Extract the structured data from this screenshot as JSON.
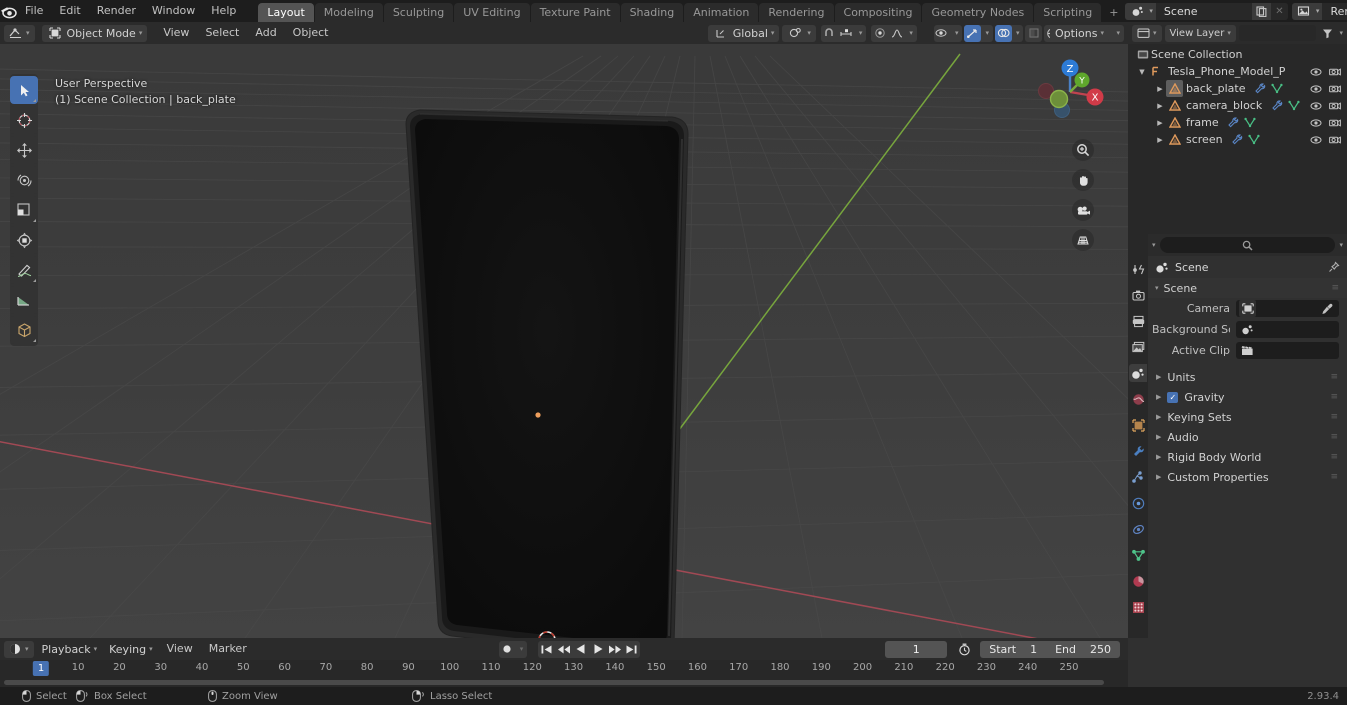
{
  "app": {
    "name": "Blender",
    "version": "2.93.4"
  },
  "topbar": {
    "menus": [
      "File",
      "Edit",
      "Render",
      "Window",
      "Help"
    ],
    "workspace_tabs": [
      {
        "label": "Layout",
        "active": true
      },
      {
        "label": "Modeling",
        "active": false
      },
      {
        "label": "Sculpting",
        "active": false
      },
      {
        "label": "UV Editing",
        "active": false
      },
      {
        "label": "Texture Paint",
        "active": false
      },
      {
        "label": "Shading",
        "active": false
      },
      {
        "label": "Animation",
        "active": false
      },
      {
        "label": "Rendering",
        "active": false
      },
      {
        "label": "Compositing",
        "active": false
      },
      {
        "label": "Geometry Nodes",
        "active": false
      },
      {
        "label": "Scripting",
        "active": false
      }
    ],
    "add_workspace_label": "+",
    "scene_name": "Scene",
    "viewlayer_name": "RenderLayer"
  },
  "viewport_header": {
    "mode": "Object Mode",
    "menus": [
      "View",
      "Select",
      "Add",
      "Object"
    ],
    "transform_orientation": "Global",
    "options_label": "Options"
  },
  "viewport": {
    "perspective_label": "User Perspective",
    "collection_label": "(1) Scene Collection | back_plate",
    "gizmo_axes": [
      "Z",
      "Y",
      "X"
    ],
    "tools": [
      "tweak-select-tool",
      "cursor-tool",
      "move-tool",
      "rotate-tool",
      "scale-tool",
      "transform-tool",
      "annotate-tool",
      "measure-tool",
      "add-cube-tool"
    ],
    "nav_buttons": [
      "zoom-icon",
      "pan-hand-icon",
      "camera-view-icon",
      "toggle-perspective-icon"
    ]
  },
  "outliner": {
    "scene_collection_label": "Scene Collection",
    "items": [
      {
        "label": "Tesla_Phone_Model_Pi_Screen",
        "type": "armature-collection",
        "depth": 0,
        "selected": false,
        "expanded": true
      },
      {
        "label": "back_plate",
        "type": "mesh",
        "depth": 1,
        "selected": true,
        "expanded": false
      },
      {
        "label": "camera_block",
        "type": "mesh",
        "depth": 1,
        "selected": false,
        "expanded": false
      },
      {
        "label": "frame",
        "type": "mesh",
        "depth": 1,
        "selected": false,
        "expanded": false
      },
      {
        "label": "screen",
        "type": "mesh",
        "depth": 1,
        "selected": false,
        "expanded": false
      }
    ]
  },
  "properties": {
    "active_tab": "scene-properties",
    "tabs": [
      "tool-properties",
      "render-properties",
      "output-properties",
      "viewlayer-properties",
      "scene-properties",
      "world-properties",
      "object-properties",
      "modifier-properties",
      "particle-properties",
      "physics-properties",
      "constraint-properties",
      "data-properties",
      "material-properties",
      "texture-properties"
    ],
    "breadcrumb": "Scene",
    "panel_title": "Scene",
    "fields": [
      {
        "label": "Camera",
        "value": "",
        "icon": "camera-icon"
      },
      {
        "label": "Background Sce...",
        "value": "",
        "icon": "scene-icon"
      },
      {
        "label": "Active Clip",
        "value": "",
        "icon": "clip-icon"
      }
    ],
    "sub_panels": [
      {
        "label": "Units",
        "checkbox": null
      },
      {
        "label": "Gravity",
        "checkbox": true
      },
      {
        "label": "Keying Sets",
        "checkbox": null
      },
      {
        "label": "Audio",
        "checkbox": null
      },
      {
        "label": "Rigid Body World",
        "checkbox": null
      },
      {
        "label": "Custom Properties",
        "checkbox": null
      }
    ]
  },
  "timeline": {
    "menus": [
      "Playback",
      "Keying",
      "View",
      "Marker"
    ],
    "current_frame": "1",
    "start_label": "Start",
    "start_value": "1",
    "end_label": "End",
    "end_value": "250",
    "playhead_label": "1",
    "ticks": [
      10,
      20,
      30,
      40,
      50,
      60,
      70,
      80,
      90,
      100,
      110,
      120,
      130,
      140,
      150,
      160,
      170,
      180,
      190,
      200,
      210,
      220,
      230,
      240,
      250
    ]
  },
  "statusbar": {
    "items": [
      {
        "icon": "mouse-left-icon",
        "label": "Select"
      },
      {
        "icon": "mouse-left-drag-icon",
        "label": "Box Select"
      },
      {
        "icon": "mouse-middle-icon",
        "label": "Zoom View"
      },
      {
        "icon": "mouse-right-icon",
        "label": "Lasso Select"
      }
    ],
    "version": "2.93.4"
  },
  "colors": {
    "accent_blue": "#4772b3",
    "header_bg": "#2b2b2b",
    "panel_bg": "#303030",
    "viewport_bg": "#3d3d3d",
    "axis_x_red": "#cc4455",
    "axis_y_green": "#7fbf3f",
    "object_orange": "#ed9e5c"
  }
}
